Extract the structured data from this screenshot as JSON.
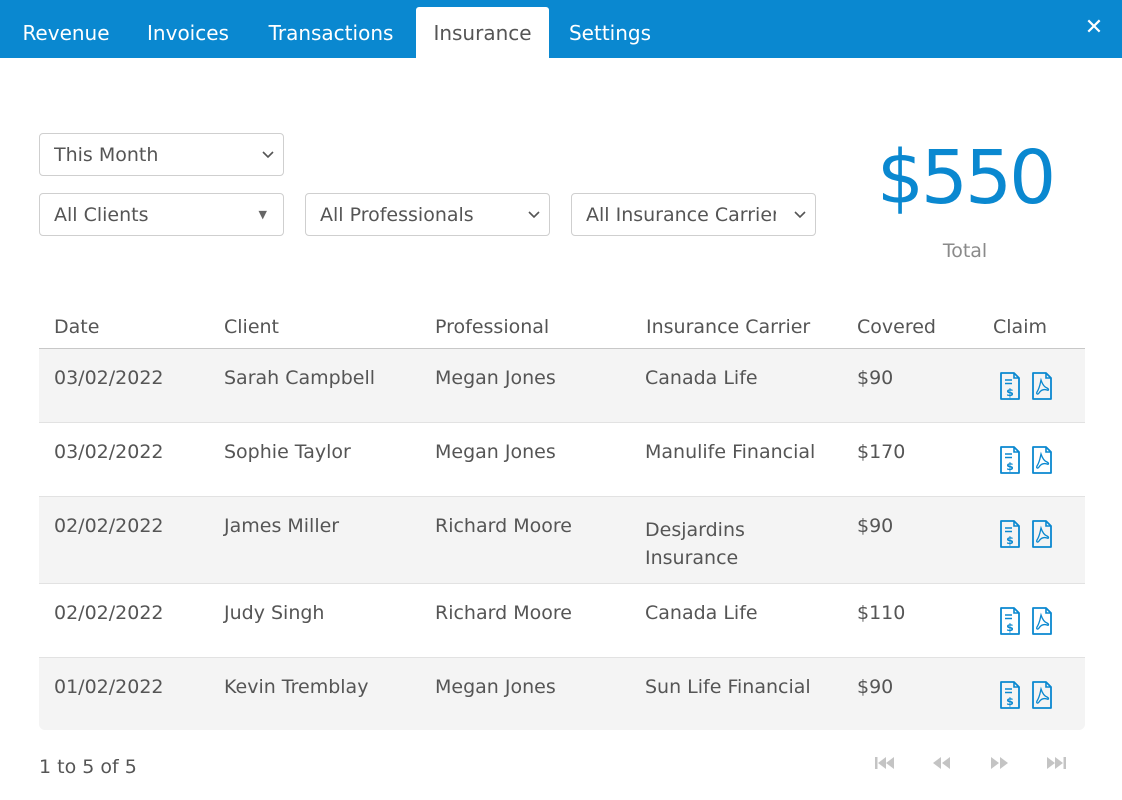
{
  "tabs": [
    {
      "label": "Revenue"
    },
    {
      "label": "Invoices"
    },
    {
      "label": "Transactions"
    },
    {
      "label": "Insurance",
      "active": true
    },
    {
      "label": "Settings"
    }
  ],
  "close_icon": "close-icon",
  "filters": {
    "period": "This Month",
    "clients": "All Clients",
    "professionals": "All Professionals",
    "carriers": "All Insurance Carriers"
  },
  "total": {
    "amount": "$550",
    "label": "Total"
  },
  "table": {
    "headers": [
      "Date",
      "Client",
      "Professional",
      "Insurance Carrier",
      "Covered",
      "Claim"
    ],
    "rows": [
      {
        "date": "03/02/2022",
        "client": "Sarah Campbell",
        "professional": "Megan Jones",
        "carrier": "Canada Life",
        "covered": "$90"
      },
      {
        "date": "03/02/2022",
        "client": "Sophie Taylor",
        "professional": "Megan Jones",
        "carrier": "Manulife Financial",
        "covered": "$170"
      },
      {
        "date": "02/02/2022",
        "client": "James Miller",
        "professional": "Richard Moore",
        "carrier": "Desjardins Insurance",
        "covered": "$90"
      },
      {
        "date": "02/02/2022",
        "client": "Judy Singh",
        "professional": "Richard Moore",
        "carrier": "Canada Life",
        "covered": "$110"
      },
      {
        "date": "01/02/2022",
        "client": "Kevin Tremblay",
        "professional": "Megan Jones",
        "carrier": "Sun Life Financial",
        "covered": "$90"
      }
    ]
  },
  "pagination": {
    "summary": "1 to 5 of 5"
  },
  "colors": {
    "accent": "#0a88d0",
    "row_shade": "#f4f4f4"
  }
}
